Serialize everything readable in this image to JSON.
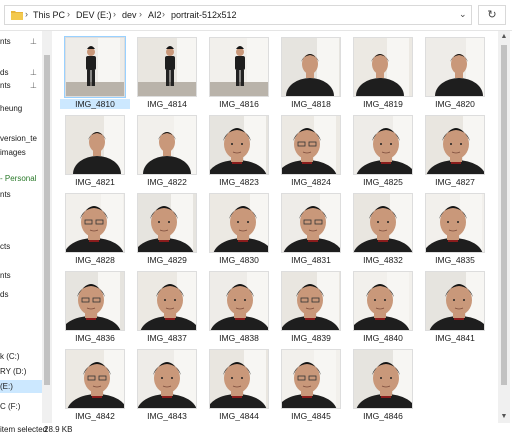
{
  "address": {
    "crumbs": [
      "This PC",
      "DEV (E:)",
      "dev",
      "AI2",
      "portrait-512x512"
    ],
    "separator": "›",
    "caret": "⌄",
    "refresh_icon": "↻"
  },
  "nav": {
    "items": [
      {
        "label": "ds",
        "pinned": true
      },
      {
        "label": "nts",
        "pinned": true
      },
      {
        "label": "ds",
        "pinned": true
      },
      {
        "label": "nts",
        "pinned": true
      },
      {
        "label": "heung",
        "pinned": false
      },
      {
        "label": "version_te",
        "pinned": false
      },
      {
        "label": "images",
        "pinned": false
      },
      {
        "label": "- Personal",
        "pinned": false,
        "green": true
      },
      {
        "label": "nts",
        "pinned": false
      },
      {
        "label": "cts",
        "pinned": false
      },
      {
        "label": "nts",
        "pinned": false
      },
      {
        "label": "ds",
        "pinned": false
      },
      {
        "label": "k (C:)",
        "pinned": false
      },
      {
        "label": "RY (D:)",
        "pinned": false
      },
      {
        "label": "(E:)",
        "pinned": false,
        "selected": true
      },
      {
        "label": "C (F:)",
        "pinned": false
      }
    ],
    "pin_icon": "📌"
  },
  "files": [
    {
      "name": "IMG_4810",
      "kind": "full",
      "selected": true
    },
    {
      "name": "IMG_4814",
      "kind": "full"
    },
    {
      "name": "IMG_4816",
      "kind": "full"
    },
    {
      "name": "IMG_4818",
      "kind": "bust"
    },
    {
      "name": "IMG_4819",
      "kind": "bust"
    },
    {
      "name": "IMG_4820",
      "kind": "bust"
    },
    {
      "name": "IMG_4821",
      "kind": "bust"
    },
    {
      "name": "IMG_4822",
      "kind": "bust"
    },
    {
      "name": "IMG_4823",
      "kind": "face"
    },
    {
      "name": "IMG_4824",
      "kind": "face"
    },
    {
      "name": "IMG_4825",
      "kind": "face"
    },
    {
      "name": "IMG_4827",
      "kind": "face"
    },
    {
      "name": "IMG_4828",
      "kind": "face"
    },
    {
      "name": "IMG_4829",
      "kind": "face"
    },
    {
      "name": "IMG_4830",
      "kind": "face"
    },
    {
      "name": "IMG_4831",
      "kind": "face"
    },
    {
      "name": "IMG_4832",
      "kind": "face"
    },
    {
      "name": "IMG_4835",
      "kind": "face"
    },
    {
      "name": "IMG_4836",
      "kind": "face"
    },
    {
      "name": "IMG_4837",
      "kind": "face"
    },
    {
      "name": "IMG_4838",
      "kind": "face"
    },
    {
      "name": "IMG_4839",
      "kind": "face"
    },
    {
      "name": "IMG_4840",
      "kind": "face"
    },
    {
      "name": "IMG_4841",
      "kind": "face"
    },
    {
      "name": "IMG_4842",
      "kind": "face"
    },
    {
      "name": "IMG_4843",
      "kind": "face"
    },
    {
      "name": "IMG_4844",
      "kind": "face"
    },
    {
      "name": "IMG_4845",
      "kind": "face"
    },
    {
      "name": "IMG_4846",
      "kind": "face"
    }
  ],
  "status": {
    "selected_text": "item selected",
    "size_text": "28.9 KB"
  },
  "colors": {
    "selection": "#cce8ff",
    "folder": "#e8b53a",
    "shirt": "#1e1e1e",
    "skin": "#c9987a",
    "hair": "#141414"
  }
}
